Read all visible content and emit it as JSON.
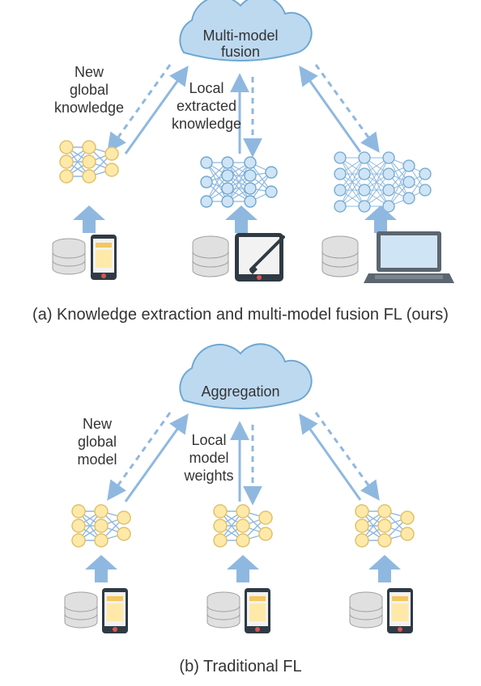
{
  "panel_a": {
    "caption": "(a) Knowledge extraction and multi-model fusion FL (ours)",
    "cloud_line1": "Multi-model",
    "cloud_line2": "fusion",
    "left_label_line1": "New",
    "left_label_line2": "global",
    "left_label_line3": "knowledge",
    "mid_label_line1": "Local",
    "mid_label_line2": "extracted",
    "mid_label_line3": "knowledge"
  },
  "panel_b": {
    "caption": "(b) Traditional FL",
    "cloud_line1": "Aggregation",
    "left_label_line1": "New",
    "left_label_line2": "global",
    "left_label_line3": "model",
    "mid_label_line1": "Local",
    "mid_label_line2": "model",
    "mid_label_line3": "weights"
  },
  "colors": {
    "blue_light": "#BDD9F0",
    "blue_stroke": "#6FA8D1",
    "arrow": "#8FB8E0",
    "yellow_light": "#FFE9A8",
    "yellow_stroke": "#E0C16A",
    "grey_fill": "#E6E6E6",
    "grey_stroke": "#9E9E9E",
    "laptop_body": "#5C6670",
    "tablet_body": "#2F3A44",
    "phone_body": "#2F3A44",
    "db_fill": "#E0E0E0",
    "db_stroke": "#A0A0A0"
  }
}
